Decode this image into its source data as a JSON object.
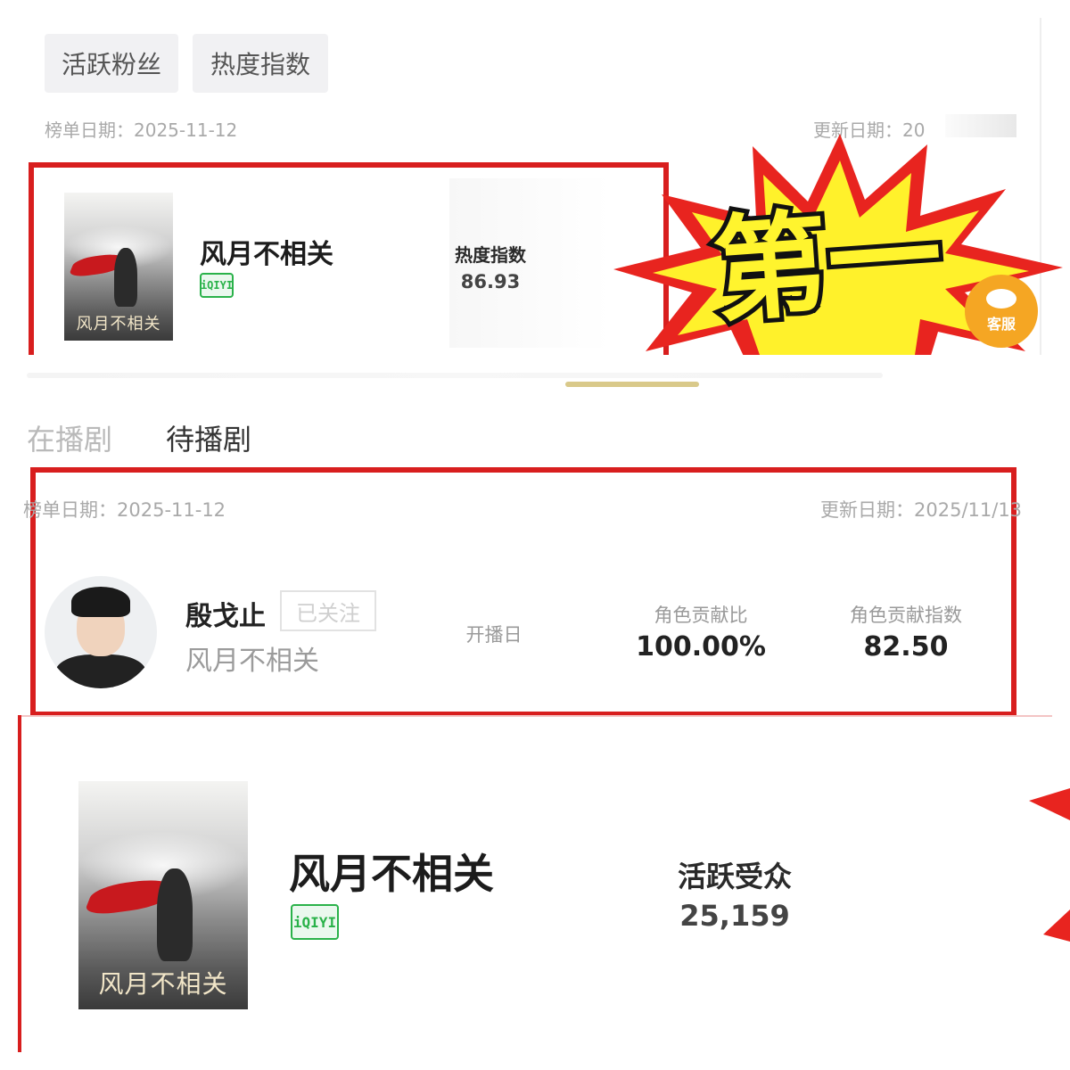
{
  "colors": {
    "accent_red": "#d81e1e",
    "iqiyi_green": "#2ab24a",
    "gold_bar": "#d9c98a",
    "badge_orange": "#f5a623"
  },
  "panel1": {
    "tabs": [
      {
        "label": "活跃粉丝"
      },
      {
        "label": "热度指数"
      }
    ],
    "list_date": "榜单日期：2025-11-12",
    "update_date": "更新日期：20",
    "show": {
      "title": "风月不相关",
      "platform": "iQIYI",
      "poster_text": "风月不相关"
    },
    "metric": {
      "label": "热度指数",
      "value": "86.93"
    },
    "sticker": {
      "text": "第一"
    },
    "customer_service": {
      "label": "客服"
    }
  },
  "panel2": {
    "tabs": [
      {
        "label": "在播剧"
      },
      {
        "label": "待播剧"
      }
    ],
    "list_date": "榜单日期：2025-11-12",
    "update_date": "更新日期：2025/11/13",
    "actor": {
      "name": "殷戈止",
      "follow_status": "已关注",
      "show": "风月不相关"
    },
    "air_label": "开播日",
    "contrib_ratio": {
      "label": "角色贡献比",
      "value": "100.00%"
    },
    "contrib_index": {
      "label": "角色贡献指数",
      "value": "82.50"
    }
  },
  "panel3": {
    "show": {
      "title": "风月不相关",
      "platform": "iQIYI",
      "poster_text": "风月不相关"
    },
    "metric": {
      "label": "活跃受众",
      "value": "25,159"
    }
  }
}
